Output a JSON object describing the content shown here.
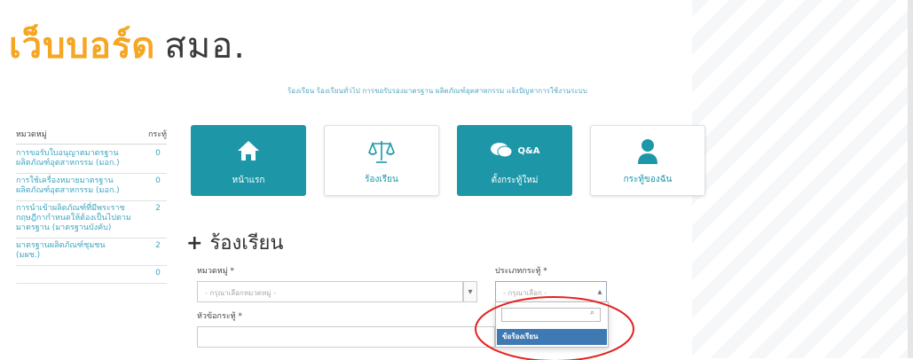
{
  "logo": {
    "part1": "เว็บบอร์ด",
    "part2": "สมอ."
  },
  "subnav": {
    "text": "ร้องเรียน ร้องเรียนทั่วไป การขอรับรองมาตรฐาน ผลิตภัณฑ์อุตสาหกรรม แจ้งปัญหาการใช้งานระบบ"
  },
  "sidebar": {
    "header_category": "หมวดหมู่",
    "header_count": "กระทู้",
    "items": [
      {
        "label": "การขอรับใบอนุญาตมาตรฐานผลิตภัณฑ์อุตสาหกรรม (มอก.)",
        "count": "0"
      },
      {
        "label": "การใช้เครื่องหมายมาตรฐานผลิตภัณฑ์อุตสาหกรรม (มอก.)",
        "count": "0"
      },
      {
        "label": "การนำเข้าผลิตภัณฑ์ที่มีพระราชกฤษฎีกากำหนดให้ต้องเป็นไปตามมาตรฐาน (มาตรฐานบังคับ)",
        "count": "2"
      },
      {
        "label": "มาตรฐานผลิตภัณฑ์ชุมชน (มผช.)",
        "count": "2"
      },
      {
        "label": "",
        "count": "0"
      }
    ]
  },
  "tiles": [
    {
      "label": "หน้าแรก",
      "icon": "home-icon"
    },
    {
      "label": "ร้องเรียน",
      "icon": "scale-icon"
    },
    {
      "label": "ตั้งกระทู้ใหม่",
      "icon": "qa-icon",
      "badge": "Q&A"
    },
    {
      "label": "กระทู้ของฉัน",
      "icon": "user-icon"
    }
  ],
  "section": {
    "title": "ร้องเรียน",
    "plus": "+"
  },
  "form": {
    "category_label": "หมวดหมู่ *",
    "category_placeholder": "- กรุณาเลือกหมวดหมู่ -",
    "topic_type_label": "ประเภทกระทู้ *",
    "topic_type_placeholder": "- กรุณาเลือก -",
    "subject_label": "หัวข้อกระทู้ *"
  },
  "dropdown": {
    "search_value": "",
    "options": [
      "ข้อร้องเรียน"
    ],
    "search_icon": "search-icon"
  },
  "annotation": {
    "color": "#e52222"
  },
  "colors": {
    "accent": "#1d97a8",
    "logo_orange": "#f5a623",
    "selected": "#3e79b3"
  }
}
